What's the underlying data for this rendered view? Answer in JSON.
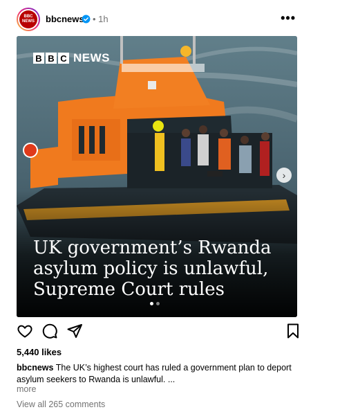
{
  "post": {
    "account": {
      "handle": "bbcnews",
      "avatar_text_top": "BBC",
      "avatar_text_bottom": "NEWS",
      "verified": true,
      "time": "• 1h"
    },
    "more_options_icon": "more-horizontal-icon",
    "image": {
      "brand_letters": [
        "B",
        "B",
        "C"
      ],
      "brand_word": "NEWS",
      "headline": "UK government’s Rwanda asylum policy is unlawful, Supreme Court rules",
      "carousel": {
        "count": 2,
        "active_index": 0
      }
    },
    "actions": {
      "like_icon": "heart-icon",
      "comment_icon": "comment-icon",
      "share_icon": "send-icon",
      "save_icon": "bookmark-icon"
    },
    "likes": "5,440 likes",
    "caption": {
      "author": "bbcnews",
      "text": "The UK’s highest court has ruled a government plan to deport asylum seekers to Rwanda is unlawful. ..."
    },
    "more_label": "more",
    "view_comments": "View all 265 comments"
  },
  "colors": {
    "brand_red": "#b80000",
    "muted_text": "#737373",
    "lifeboat_orange": "#f07a1e"
  }
}
